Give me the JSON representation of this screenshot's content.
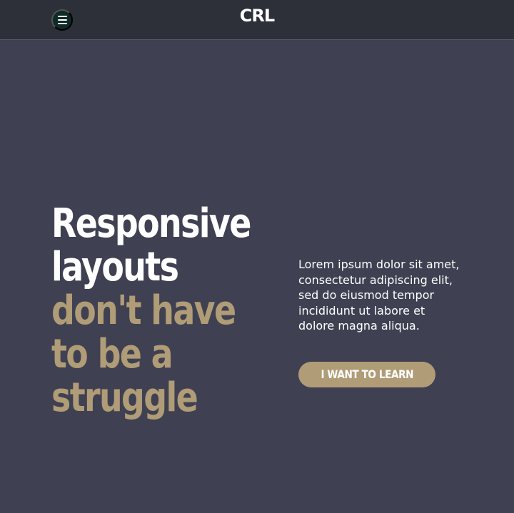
{
  "header": {
    "logo": "CRL",
    "menu_icon": "hamburger-menu-icon"
  },
  "hero": {
    "headline_light": [
      "Responsive",
      "layouts"
    ],
    "headline_accent": [
      "don't have",
      "to be a",
      "struggle"
    ],
    "body": "Lorem ipsum dolor sit amet, consectetur adipiscing elit, sed do eiusmod tempor incididunt ut labore et dolore magna aliqua.",
    "cta_label": "I WANT TO LEARN"
  },
  "colors": {
    "background": "#3f4152",
    "header": "#2d2f39",
    "accent": "#b09c76",
    "menu_button": "#0f2a27",
    "text": "#ffffff"
  }
}
